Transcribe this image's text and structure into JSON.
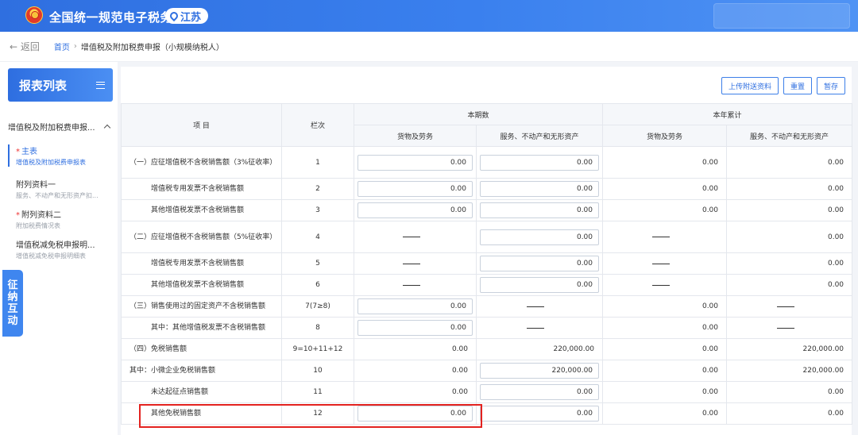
{
  "header": {
    "brand": "全国统一规范电子税务局",
    "region": "江苏"
  },
  "breadcrumb": {
    "back": "← 返回",
    "home": "首页",
    "sep": "›",
    "current": "增值税及附加税费申报（小规模纳税人）"
  },
  "sidebar": {
    "title": "报表列表",
    "group": "增值税及附加税费申报...",
    "items": [
      {
        "required": true,
        "label": "主表",
        "sub": "增值税及附加税费申报表"
      },
      {
        "required": false,
        "label": "附列资料一",
        "sub": "服务、不动产和无形资产扣..."
      },
      {
        "required": true,
        "label": "附列资料二",
        "sub": "附加税费情况表"
      },
      {
        "required": false,
        "label": "增值税减免税申报明...",
        "sub": "增值税减免税申报明细表"
      }
    ],
    "float_tab": [
      "征",
      "纳",
      "互",
      "动"
    ]
  },
  "actions": {
    "upload": "上传附送资料",
    "reset": "重置",
    "save": "暂存"
  },
  "table": {
    "h_project": "项 目",
    "h_column": "栏次",
    "h_current": "本期数",
    "h_ytd": "本年累计",
    "h_goods": "货物及劳务",
    "h_services": "服务、不动产和无形资产",
    "rows": [
      {
        "label": "（一）应征增值税不含税销售额（3%征收率）",
        "col": "1",
        "c1": "0.00",
        "c2": "0.00",
        "y1": "0.00",
        "y2": "0.00"
      },
      {
        "label": "增值税专用发票不含税销售额",
        "col": "2",
        "c1": "0.00",
        "c2": "0.00",
        "y1": "0.00",
        "y2": "0.00"
      },
      {
        "label": "其他增值税发票不含税销售额",
        "col": "3",
        "c1": "0.00",
        "c2": "0.00",
        "y1": "0.00",
        "y2": "0.00"
      },
      {
        "label": "（二）应征增值税不含税销售额（5%征收率）",
        "col": "4",
        "c1": "——",
        "c2": "0.00",
        "y1": "——",
        "y2": "0.00"
      },
      {
        "label": "增值税专用发票不含税销售额",
        "col": "5",
        "c1": "——",
        "c2": "0.00",
        "y1": "——",
        "y2": "0.00"
      },
      {
        "label": "其他增值税发票不含税销售额",
        "col": "6",
        "c1": "——",
        "c2": "0.00",
        "y1": "——",
        "y2": "0.00"
      },
      {
        "label": "（三）销售使用过的固定资产不含税销售额",
        "col": "7(7≥8)",
        "c1": "0.00",
        "c2": "——",
        "y1": "0.00",
        "y2": "——"
      },
      {
        "label": "其中：其他增值税发票不含税销售额",
        "col": "8",
        "c1": "0.00",
        "c2": "——",
        "y1": "0.00",
        "y2": "——"
      },
      {
        "label": "（四）免税销售额",
        "col": "9=10+11+12",
        "c1": "0.00",
        "c2": "220,000.00",
        "y1": "0.00",
        "y2": "220,000.00"
      },
      {
        "label": "其中：小微企业免税销售额",
        "col": "10",
        "c1": "0.00",
        "c2": "220,000.00",
        "y1": "0.00",
        "y2": "220,000.00"
      },
      {
        "label": "未达起征点销售额",
        "col": "11",
        "c1": "0.00",
        "c2": "0.00",
        "y1": "0.00",
        "y2": "0.00"
      },
      {
        "label": "其他免税销售额",
        "col": "12",
        "c1": "0.00",
        "c2": "0.00",
        "y1": "0.00",
        "y2": "0.00"
      }
    ]
  },
  "colors": {
    "brand_blue": "#2f6fe0",
    "highlight_red": "#e3221f"
  }
}
